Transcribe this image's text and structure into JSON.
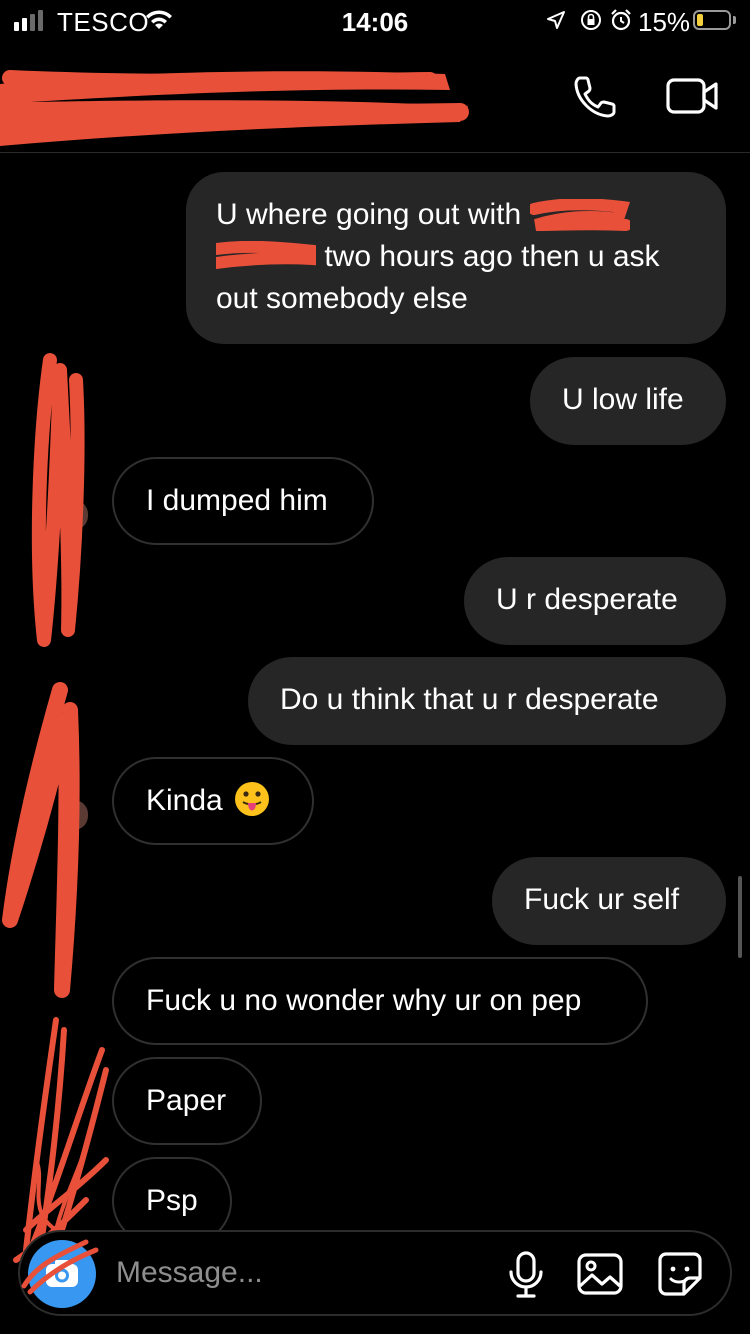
{
  "status_bar": {
    "carrier": "TESCO",
    "time": "14:06",
    "battery": "15%",
    "battery_level": 0.15
  },
  "header": {
    "call_icon": "phone-icon",
    "video_icon": "video-camera-icon"
  },
  "messages": [
    {
      "direction": "outgoing",
      "lines": [
        "U where going out with",
        "two hours ago then u ask",
        "out somebody else"
      ]
    },
    {
      "direction": "outgoing",
      "text": "U low life"
    },
    {
      "direction": "incoming",
      "text": "I dumped him"
    },
    {
      "direction": "outgoing",
      "text": "U r desperate"
    },
    {
      "direction": "outgoing",
      "text": "Do u think that u r desperate"
    },
    {
      "direction": "incoming",
      "text": "Kinda",
      "emoji": "tongue-face-emoji"
    },
    {
      "direction": "outgoing",
      "text": "Fuck ur self"
    },
    {
      "direction": "incoming",
      "text": "Fuck u no wonder why ur on pep"
    },
    {
      "direction": "incoming",
      "text": "Paper"
    },
    {
      "direction": "incoming",
      "text": "Psp"
    }
  ],
  "composer": {
    "placeholder": "Message...",
    "icons": [
      "camera-icon",
      "microphone-icon",
      "gallery-icon",
      "sticker-icon"
    ]
  },
  "colors": {
    "background": "#000000",
    "outgoing_bubble": "#262626",
    "incoming_border": "#303030",
    "camera_button": "#3897f0",
    "redaction": "#e8503a"
  }
}
